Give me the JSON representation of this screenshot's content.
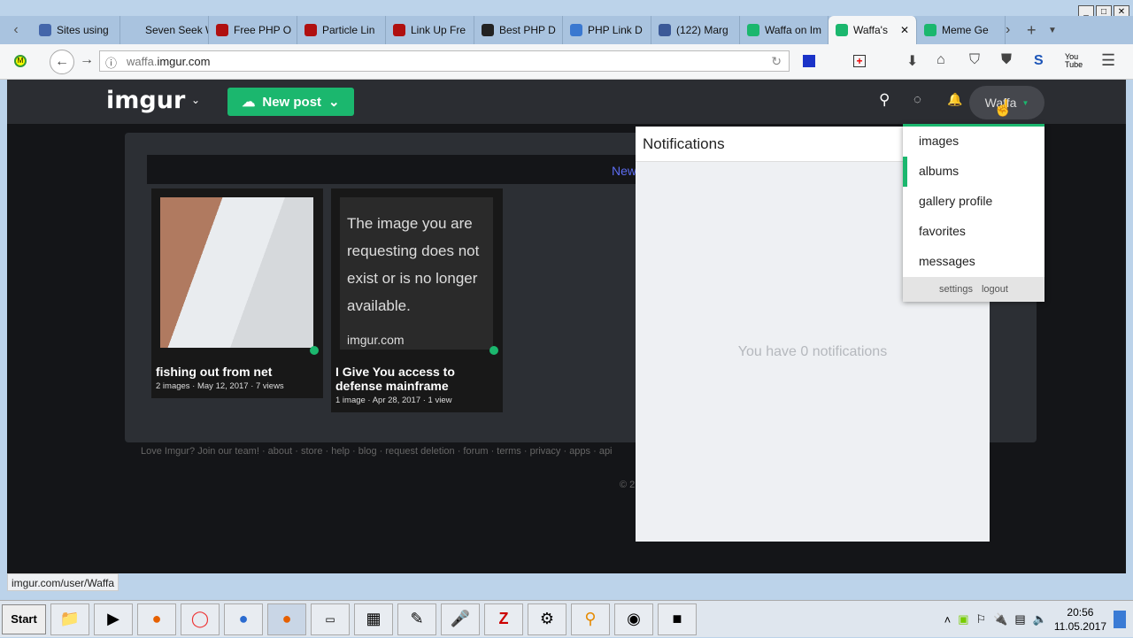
{
  "browser": {
    "tabs": [
      {
        "label": "Sites using",
        "color": "#4466aa"
      },
      {
        "label": "Seven Seek Web",
        "color": ""
      },
      {
        "label": "Free PHP O",
        "color": "#b01010"
      },
      {
        "label": "Particle Lin",
        "color": "#b01010"
      },
      {
        "label": "Link Up Fre",
        "color": "#b01010"
      },
      {
        "label": "Best PHP D",
        "color": "#222"
      },
      {
        "label": "PHP Link D",
        "color": "#3a78d0"
      },
      {
        "label": "(122) Marg",
        "color": "#3b5998"
      },
      {
        "label": "Waffa on Im",
        "color": "#1bb76e"
      },
      {
        "label": "Waffa's",
        "color": "#1bb76e",
        "active": true
      },
      {
        "label": "Meme Ge",
        "color": "#1bb76e"
      }
    ],
    "url_prefix": "waffa.",
    "url_domain": "imgur.com",
    "status_url": "imgur.com/user/Waffa"
  },
  "imgur": {
    "logo": "imgur",
    "new_post": "New post",
    "username": "Waffa",
    "subheader_link": "New",
    "posts": [
      {
        "title": "fishing out from net",
        "meta": "2 images · May 12, 2017 · 7 views"
      },
      {
        "title": "I Give You access to defense mainframe",
        "meta": "1 image · Apr 28, 2017 · 1 view",
        "thumb_text": "The image you are requesting does not exist or is no longer available.",
        "thumb_brand": "imgur.com"
      }
    ],
    "footer": "Love Imgur? Join our team! · about · store · help · blog · request deletion · forum · terms · privacy · apps · api",
    "copyright": "© 2",
    "notifications": {
      "title": "Notifications",
      "empty": "You have 0 notifications"
    },
    "menu": {
      "items": [
        "images",
        "albums",
        "gallery profile",
        "favorites",
        "messages"
      ],
      "selected": "albums",
      "settings": "settings",
      "logout": "logout"
    }
  },
  "taskbar": {
    "start": "Start",
    "time": "20:56",
    "date": "11.05.2017"
  }
}
